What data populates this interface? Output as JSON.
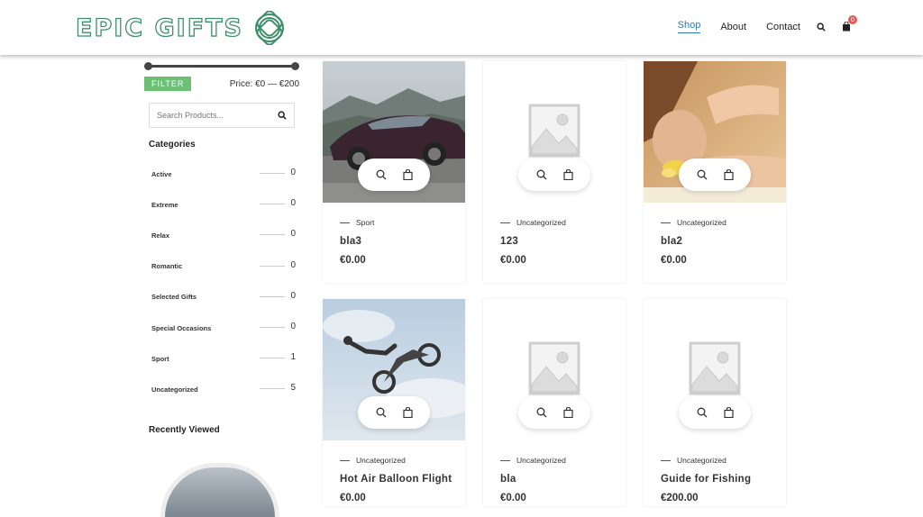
{
  "header": {
    "logo_text": "EPIC GIFTS",
    "nav": [
      {
        "label": "Shop",
        "active": true
      },
      {
        "label": "About",
        "active": false
      },
      {
        "label": "Contact",
        "active": false
      }
    ],
    "cart_count": "0"
  },
  "sidebar": {
    "filter_label": "FILTER",
    "price_label": "Price: €0 — €200",
    "search_placeholder": "Search Products...",
    "categories_title": "Categories",
    "categories": [
      {
        "name": "Active",
        "count": "0"
      },
      {
        "name": "Extreme",
        "count": "0"
      },
      {
        "name": "Relax",
        "count": "0"
      },
      {
        "name": "Romantic",
        "count": "0"
      },
      {
        "name": "Selected Gifts",
        "count": "0"
      },
      {
        "name": "Special Occasions",
        "count": "0"
      },
      {
        "name": "Sport",
        "count": "1"
      },
      {
        "name": "Uncategorized",
        "count": "5"
      }
    ],
    "recent_title": "Recently Viewed"
  },
  "products": [
    {
      "category": "Sport",
      "title": "bla3",
      "price": "€0.00",
      "image": "car"
    },
    {
      "category": "Uncategorized",
      "title": "123",
      "price": "€0.00",
      "image": "placeholder"
    },
    {
      "category": "Uncategorized",
      "title": "bla2",
      "price": "€0.00",
      "image": "massage"
    },
    {
      "category": "Uncategorized",
      "title": "Hot Air Balloon Flight",
      "price": "€0.00",
      "image": "motocross"
    },
    {
      "category": "Uncategorized",
      "title": "bla",
      "price": "€0.00",
      "image": "placeholder"
    },
    {
      "category": "Uncategorized",
      "title": "Guide for Fishing",
      "price": "€200.00",
      "image": "placeholder"
    }
  ],
  "colors": {
    "accent": "#2f7ab6",
    "filter": "#6cbf74",
    "logo": "#3d8f6b"
  }
}
